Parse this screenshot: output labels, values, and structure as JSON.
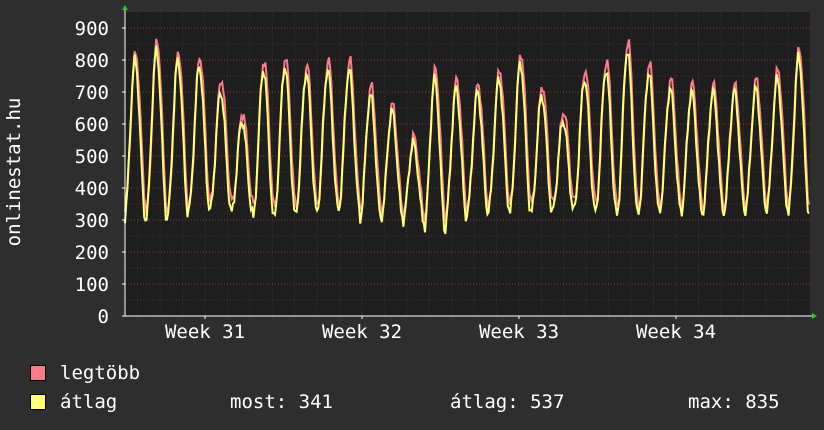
{
  "chart_data": {
    "type": "line",
    "ylabel": "onlinestat.hu",
    "ylim": [
      0,
      950
    ],
    "yticks": [
      0,
      100,
      200,
      300,
      400,
      500,
      600,
      700,
      800,
      900
    ],
    "xticks": [
      "Week 31",
      "Week 32",
      "Week 33",
      "Week 34"
    ],
    "grid": true,
    "days": 35,
    "series": [
      {
        "name": "legtöbb",
        "color": "#ff7a85",
        "daily_peaks": [
          820,
          860,
          825,
          810,
          740,
          635,
          800,
          810,
          785,
          800,
          800,
          720,
          660,
          560,
          770,
          740,
          725,
          770,
          820,
          720,
          640,
          770,
          800,
          860,
          790,
          740,
          725,
          720,
          720,
          740,
          770,
          835
        ],
        "daily_troughs": [
          340,
          320,
          330,
          350,
          360,
          350,
          330,
          340,
          340,
          350,
          350,
          330,
          330,
          320,
          300,
          330,
          340,
          350,
          350,
          350,
          355,
          360,
          345,
          335,
          340,
          350,
          345,
          340,
          345,
          350,
          360,
          340
        ]
      },
      {
        "name": "átlag",
        "color": "#ffff7a",
        "daily_peaks": [
          800,
          830,
          800,
          780,
          700,
          610,
          770,
          780,
          760,
          770,
          770,
          690,
          640,
          540,
          740,
          710,
          700,
          740,
          790,
          690,
          610,
          740,
          770,
          830,
          760,
          710,
          700,
          700,
          700,
          710,
          740,
          810
        ],
        "daily_troughs": [
          300,
          300,
          310,
          330,
          330,
          320,
          300,
          310,
          320,
          330,
          330,
          300,
          310,
          295,
          265,
          300,
          320,
          330,
          320,
          320,
          330,
          330,
          320,
          310,
          320,
          330,
          320,
          320,
          325,
          330,
          335,
          320
        ]
      }
    ]
  },
  "legend": {
    "items": [
      {
        "label": "legtöbb",
        "color": "#ff7a85"
      },
      {
        "label": "átlag",
        "color": "#ffff7a"
      }
    ],
    "most": "most: 341",
    "atlag": "átlag: 537",
    "max": "max: 835"
  }
}
